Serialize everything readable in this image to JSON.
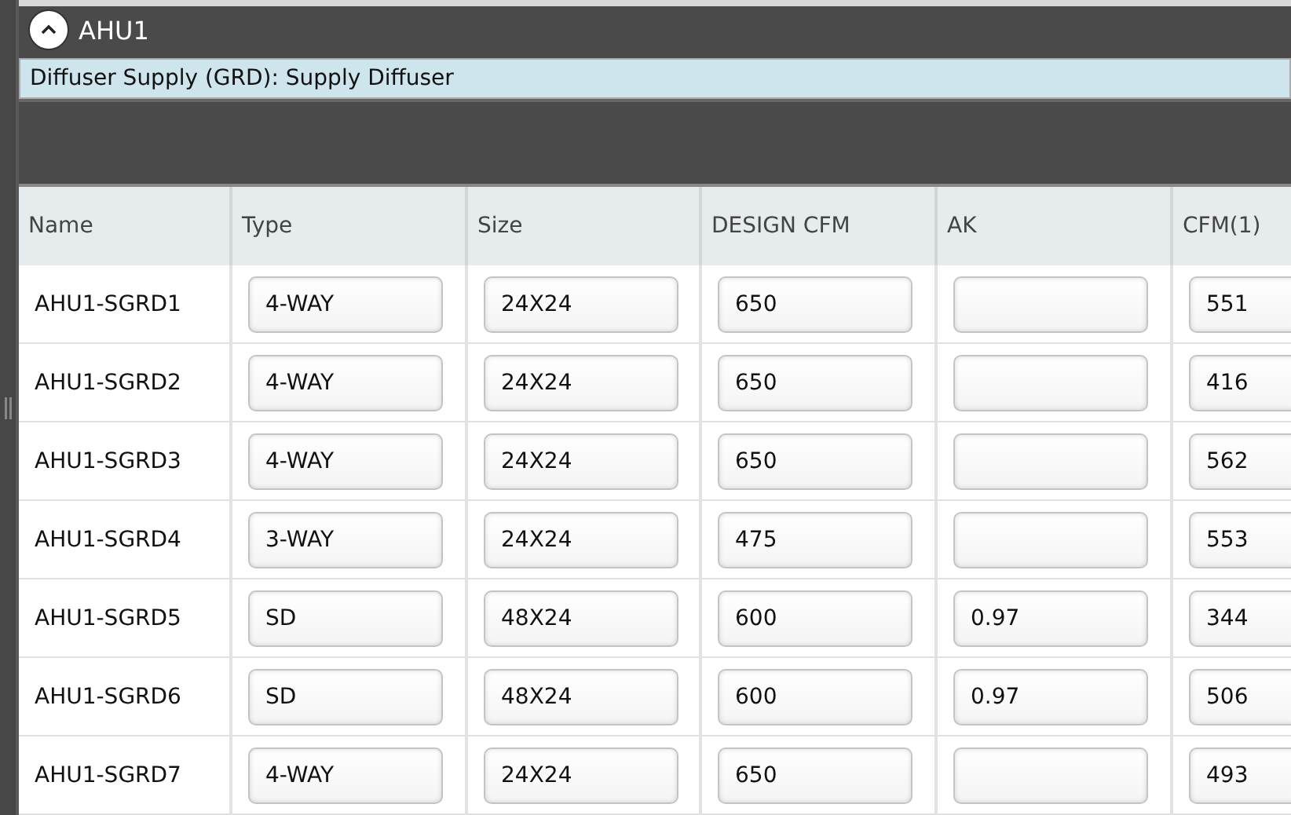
{
  "panel": {
    "title": "AHU1",
    "expanded": true
  },
  "section": {
    "label": "Diffuser Supply (GRD): Supply Diffuser"
  },
  "table": {
    "columns": [
      "Name",
      "Type",
      "Size",
      "DESIGN CFM",
      "AK",
      "CFM(1)"
    ],
    "rows": [
      {
        "name": "AHU1-SGRD1",
        "type": "4-WAY",
        "size": "24X24",
        "design_cfm": "650",
        "cfm_1": "551"
      },
      {
        "name": "AHU1-SGRD2",
        "type": "4-WAY",
        "size": "24X24",
        "design_cfm": "650",
        "cfm_1": "416"
      },
      {
        "name": "AHU1-SGRD3",
        "type": "4-WAY",
        "size": "24X24",
        "design_cfm": "650",
        "cfm_1": "562"
      },
      {
        "name": "AHU1-SGRD4",
        "type": "3-WAY",
        "size": "24X24",
        "design_cfm": "475",
        "cfm_1": "553"
      },
      {
        "name": "AHU1-SGRD5",
        "type": "SD",
        "size": "48X24",
        "design_cfm": "600",
        "ak": "0.97",
        "cfm_1": "344"
      },
      {
        "name": "AHU1-SGRD6",
        "type": "SD",
        "size": "48X24",
        "design_cfm": "600",
        "ak": "0.97",
        "cfm_1": "506"
      },
      {
        "name": "AHU1-SGRD7",
        "type": "4-WAY",
        "size": "24X24",
        "design_cfm": "650",
        "cfm_1": "493"
      }
    ]
  }
}
